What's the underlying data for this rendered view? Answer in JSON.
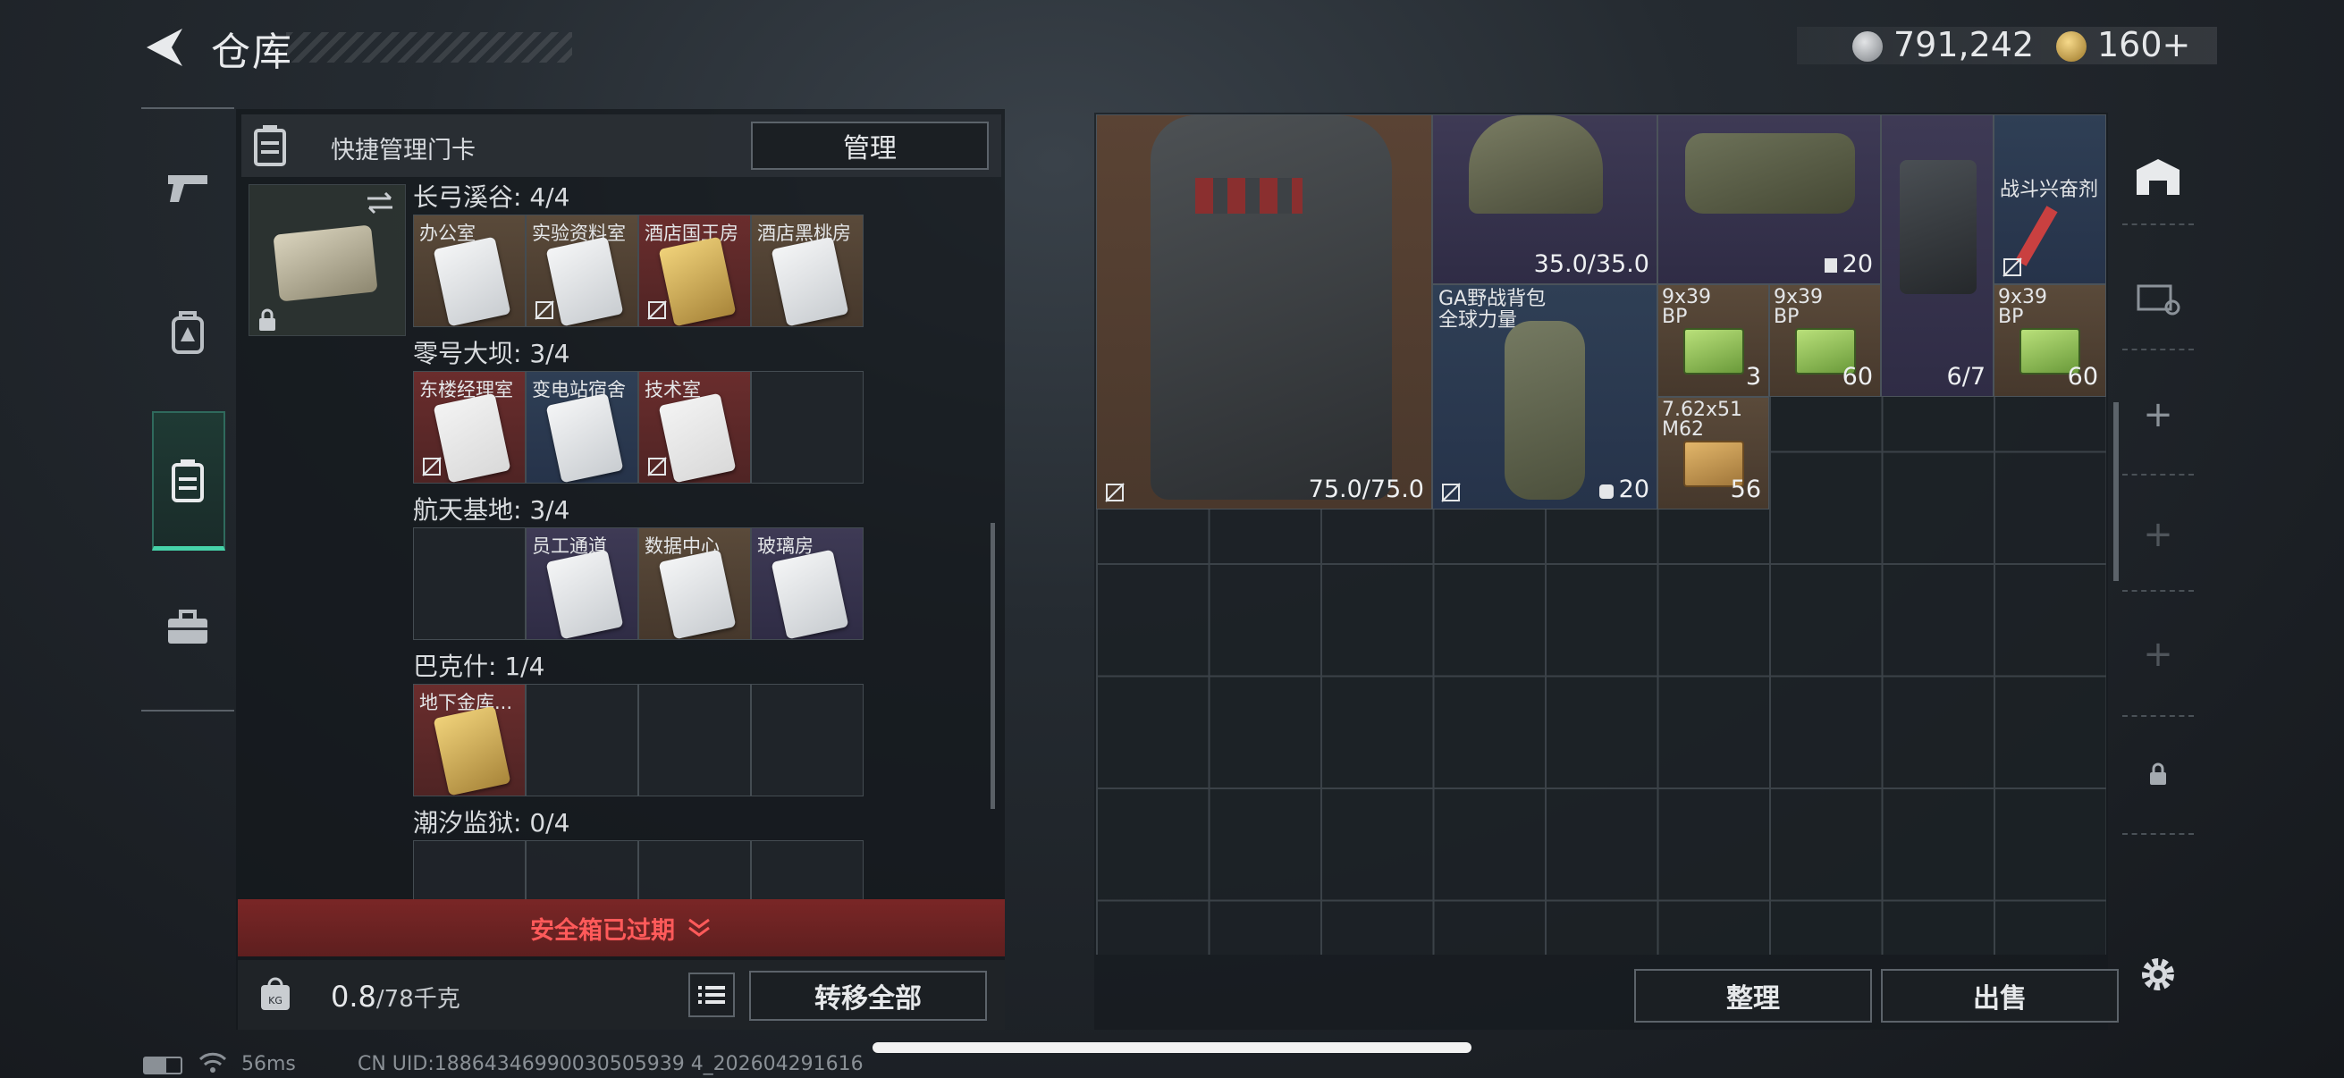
{
  "header": {
    "title": "仓库",
    "currency_silver": "791,242",
    "currency_gold": "160+"
  },
  "left_panel": {
    "header_title": "快捷管理门卡",
    "manage_button": "管理",
    "sections": [
      {
        "title": "长弓溪谷: 4/4",
        "cards": [
          {
            "name": "办公室",
            "color": "brown",
            "art": "white",
            "no_sell": false
          },
          {
            "name": "实验资料室",
            "color": "brown",
            "art": "white",
            "no_sell": true
          },
          {
            "name": "酒店国王房",
            "color": "red",
            "art": "gold",
            "no_sell": true
          },
          {
            "name": "酒店黑桃房",
            "color": "brown",
            "art": "white",
            "no_sell": false
          }
        ]
      },
      {
        "title": "零号大坝: 3/4",
        "cards": [
          {
            "name": "东楼经理室",
            "color": "red",
            "art": "redwhite",
            "no_sell": true
          },
          {
            "name": "变电站宿舍",
            "color": "blue",
            "art": "white",
            "no_sell": false
          },
          {
            "name": "技术室",
            "color": "red",
            "art": "redwhite",
            "no_sell": true
          },
          {
            "name": "",
            "color": "empty",
            "art": "",
            "no_sell": false
          }
        ]
      },
      {
        "title": "航天基地: 3/4",
        "cards": [
          {
            "name": "",
            "color": "empty",
            "art": "",
            "no_sell": false
          },
          {
            "name": "员工通道",
            "color": "purple",
            "art": "white",
            "no_sell": false
          },
          {
            "name": "数据中心",
            "color": "brown",
            "art": "white",
            "no_sell": false
          },
          {
            "name": "玻璃房",
            "color": "purple",
            "art": "white",
            "no_sell": false
          }
        ]
      },
      {
        "title": "巴克什: 1/4",
        "cards": [
          {
            "name": "地下金库...",
            "color": "red",
            "art": "gold",
            "no_sell": false
          },
          {
            "name": "",
            "color": "empty",
            "art": "",
            "no_sell": false
          },
          {
            "name": "",
            "color": "empty",
            "art": "",
            "no_sell": false
          },
          {
            "name": "",
            "color": "empty",
            "art": "",
            "no_sell": false
          }
        ]
      },
      {
        "title": "潮汐监狱: 0/4",
        "cards": [
          {
            "name": "",
            "color": "empty",
            "art": "",
            "no_sell": false
          },
          {
            "name": "",
            "color": "empty",
            "art": "",
            "no_sell": false
          },
          {
            "name": "",
            "color": "empty",
            "art": "",
            "no_sell": false
          },
          {
            "name": "",
            "color": "empty",
            "art": "",
            "no_sell": false
          }
        ]
      }
    ],
    "warning": "安全箱已过期",
    "weight_value": "0.8",
    "weight_max": "/78千克",
    "transfer_all": "转移全部"
  },
  "inventory": {
    "items": {
      "vest_durability": "75.0/75.0",
      "helmet_durability": "35.0/35.0",
      "bag_count": "20",
      "case_count": "6/7",
      "stim_name": "战斗兴奋剂",
      "backpack_name_1": "GA野战背包",
      "backpack_name_2": "全球力量",
      "backpack_count": "20",
      "ammo1_name_1": "9x39",
      "ammo1_name_2": "BP",
      "ammo1_count": "3",
      "ammo2_name_1": "9x39",
      "ammo2_name_2": "BP",
      "ammo2_count": "60",
      "ammo3_name_1": "9x39",
      "ammo3_name_2": "BP",
      "ammo3_count": "60",
      "ammo4_name_1": "7.62x51",
      "ammo4_name_2": "M62",
      "ammo4_count": "56"
    },
    "sort_button": "整理",
    "sell_button": "出售"
  },
  "status_bar": {
    "ping": "56ms",
    "uid": "CN UID:18864346990030505939 4_202604291616"
  },
  "colors": {
    "accent_green": "#46d3a9",
    "warning_red": "#ff5a5a"
  }
}
